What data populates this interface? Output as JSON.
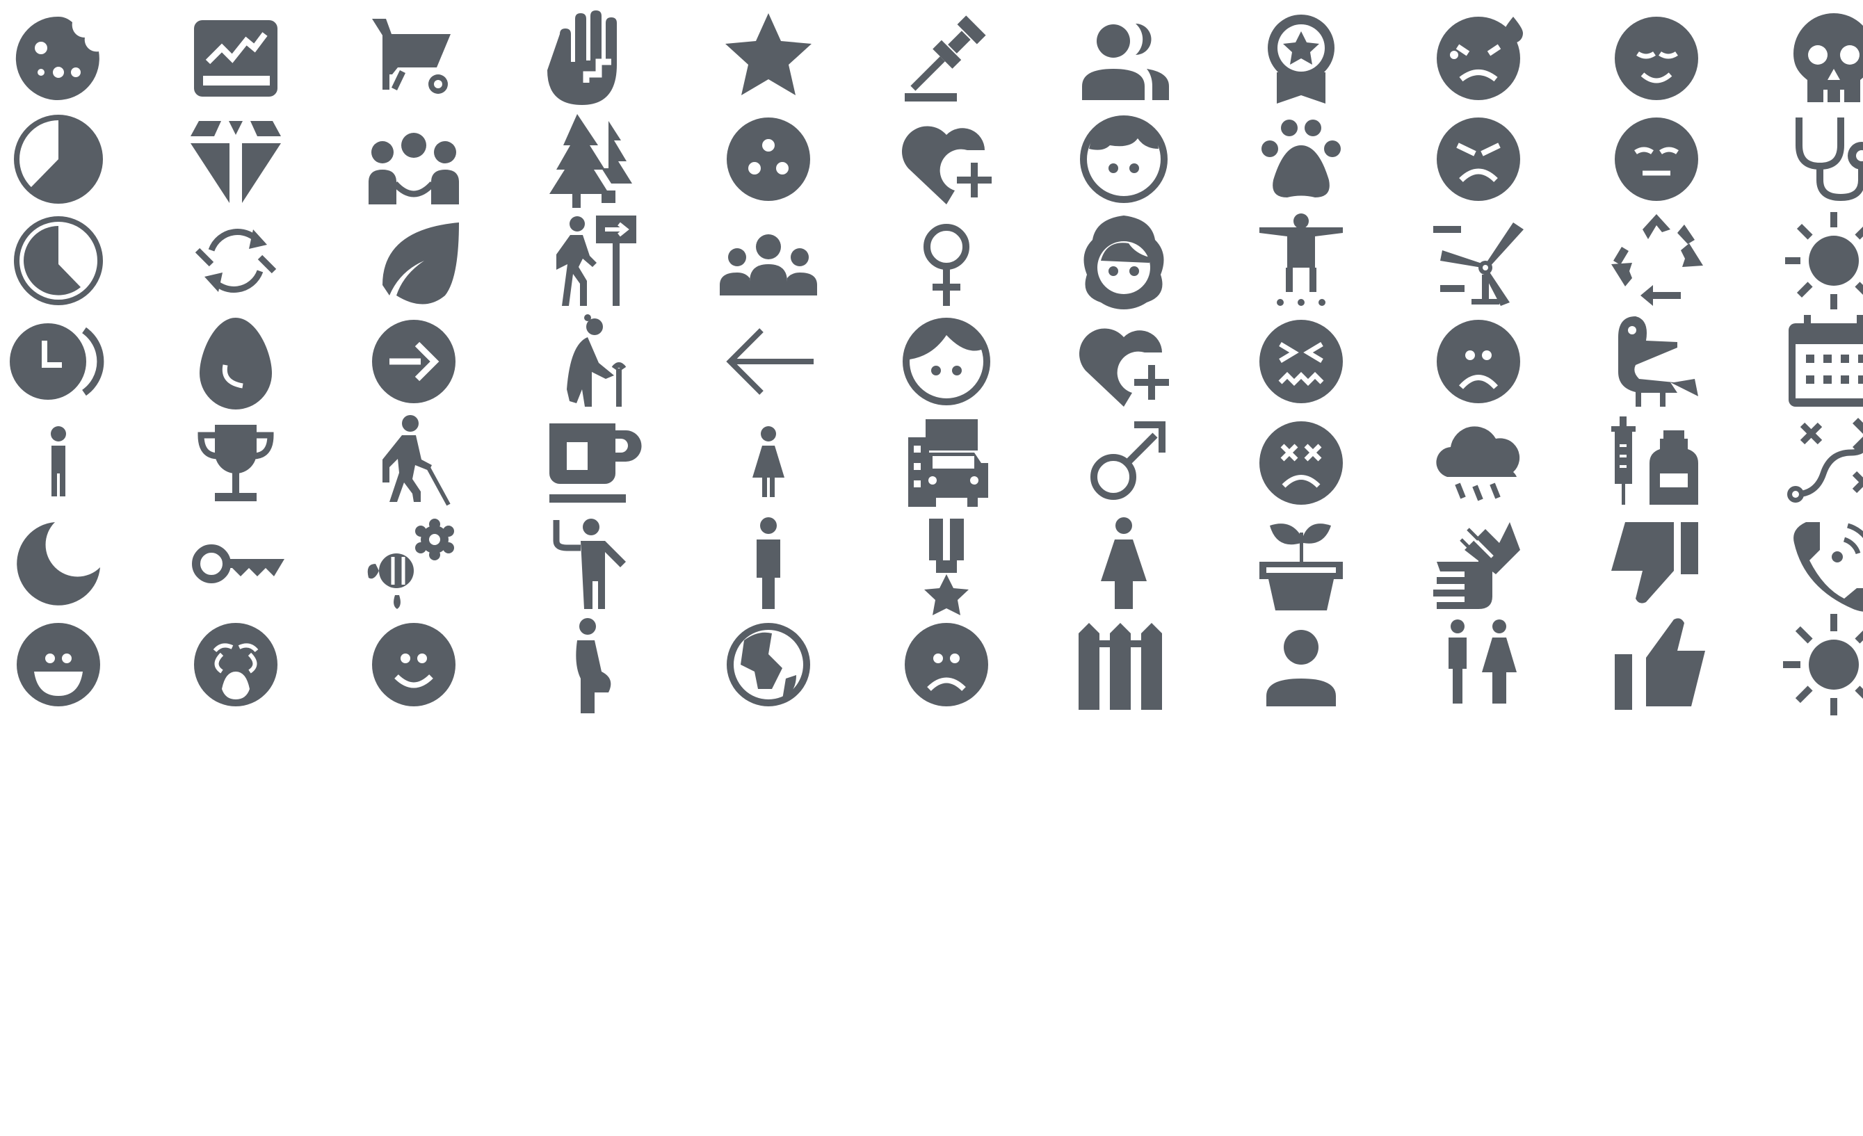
{
  "icon_color": "#585e65",
  "background": "#ffffff",
  "rows": [
    [
      "cookie-icon",
      "stock-chart-icon",
      "wheelbarrow-icon",
      "raised-hand-icon",
      "star-icon",
      "gavel-icon",
      "users-icon",
      "award-badge-icon",
      "sweating-face-icon",
      "relieved-face-icon",
      "skull-icon"
    ],
    [
      "pie-chart-icon",
      "diamonds-icon",
      "family-icon",
      "forest-icon",
      "bowling-ball-icon",
      "heart-plus-icon",
      "boy-face-icon",
      "paw-icon",
      "angry-face-icon",
      "expressionless-face-icon",
      "stethoscope-icon"
    ],
    [
      "clock-icon",
      "rotate-arrows-icon",
      "leaf-icon",
      "hiker-sign-icon",
      "group-icon",
      "female-symbol-icon",
      "child-face-icon",
      "standing-person-icon",
      "wind-turbine-icon",
      "recycle-icon",
      "sun-icon"
    ],
    [
      "clock-rewind-icon",
      "egg-icon",
      "arrow-circle-icon",
      "elderly-woman-icon",
      "arrow-left-icon",
      "girl-face-icon",
      "heart-plus-outline-icon",
      "confounded-face-icon",
      "frowning-face-icon",
      "bird-icon",
      "calendar-icon"
    ],
    [
      "man-icon",
      "trophy-icon",
      "blind-person-icon",
      "coffee-mug-icon",
      "woman-icon",
      "city-car-icon",
      "male-symbol-icon",
      "dizzy-face-icon",
      "rain-cloud-icon",
      "vaccine-icon",
      "path-icon"
    ],
    [
      "moon-icon",
      "key-icon",
      "flower-bee-icon",
      "waving-person-icon",
      "man-standing-icon",
      "medal-icon",
      "woman-standing-icon",
      "plant-pot-icon",
      "clapping-hands-icon",
      "thumbs-down-icon",
      "phone-call-icon"
    ],
    [
      "grinning-face-icon",
      "crying-face-icon",
      "smiling-face-icon",
      "pregnant-woman-icon",
      "globe-icon",
      "sad-face-icon",
      "fence-icon",
      "user-icon",
      "restroom-icon",
      "thumbs-up-icon",
      "sun-bright-icon"
    ]
  ]
}
